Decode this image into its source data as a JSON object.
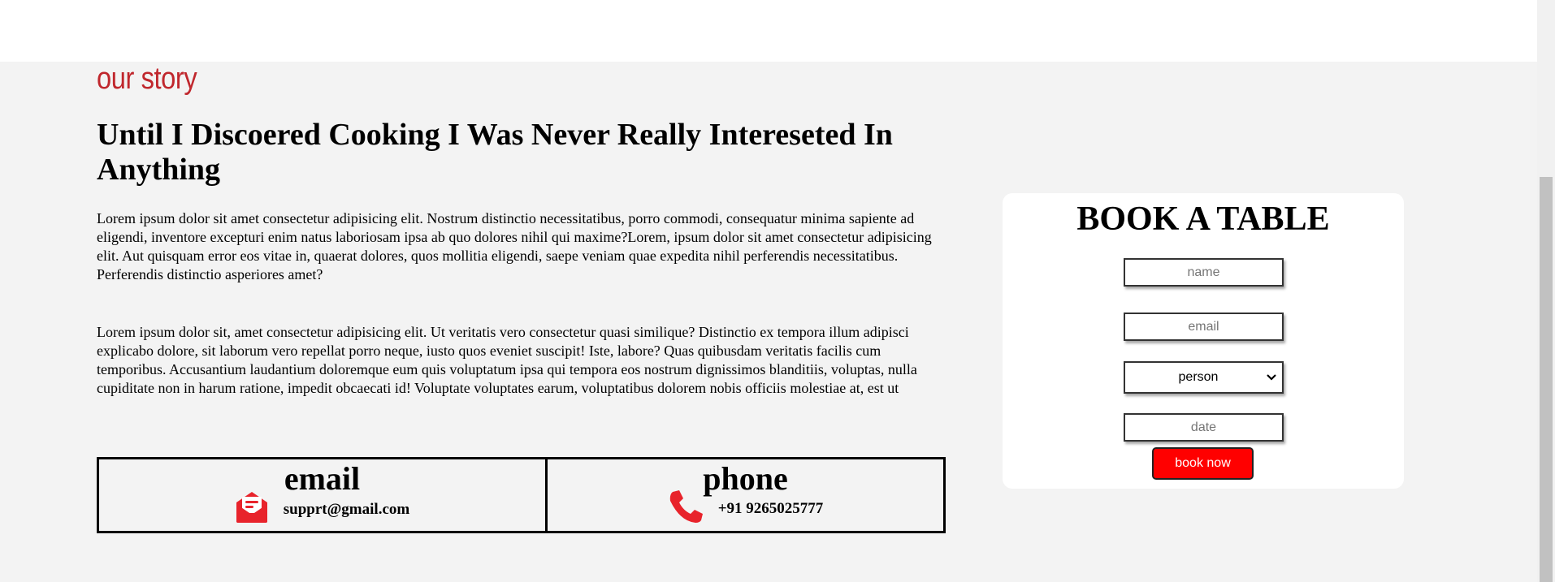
{
  "story": {
    "eyebrow": "our story",
    "headline": "Until I Discoered Cooking I Was Never Really Intereseted In Anything",
    "paragraph_1": "Lorem ipsum dolor sit amet consectetur adipisicing elit. Nostrum distinctio necessitatibus, porro commodi, consequatur minima sapiente ad eligendi, inventore excepturi enim natus laboriosam ipsa ab quo dolores nihil qui maxime?Lorem, ipsum dolor sit amet consectetur adipisicing elit. Aut quisquam error eos vitae in, quaerat dolores, quos mollitia eligendi, saepe veniam quae expedita nihil perferendis necessitatibus. Perferendis distinctio asperiores amet?",
    "paragraph_2": "Lorem ipsum dolor sit, amet consectetur adipisicing elit. Ut veritatis vero consectetur quasi similique? Distinctio ex tempora illum adipisci explicabo dolore, sit laborum vero repellat porro neque, iusto quos eveniet suscipit! Iste, labore? Quas quibusdam veritatis facilis cum temporibus. Accusantium laudantium doloremque eum quis voluptatum ipsa qui tempora eos nostrum dignissimos blanditiis, voluptas, nulla cupiditate non in harum ratione, impedit obcaecati id! Voluptate voluptates earum, voluptatibus dolorem nobis officiis molestiae at, est ut"
  },
  "contact": {
    "email": {
      "title": "email",
      "value": "supprt@gmail.com",
      "icon": "envelope-open-icon"
    },
    "phone": {
      "title": "phone",
      "value": "+91 9265025777",
      "icon": "phone-icon"
    }
  },
  "booking": {
    "title": "BOOK A TABLE",
    "name_placeholder": "name",
    "email_placeholder": "email",
    "person_selected": "person",
    "date_placeholder": "date",
    "submit_label": "book now"
  },
  "colors": {
    "accent": "#c0272d",
    "button": "#ff0000",
    "icon": "#e8232b",
    "section_bg": "#f3f3f3"
  }
}
